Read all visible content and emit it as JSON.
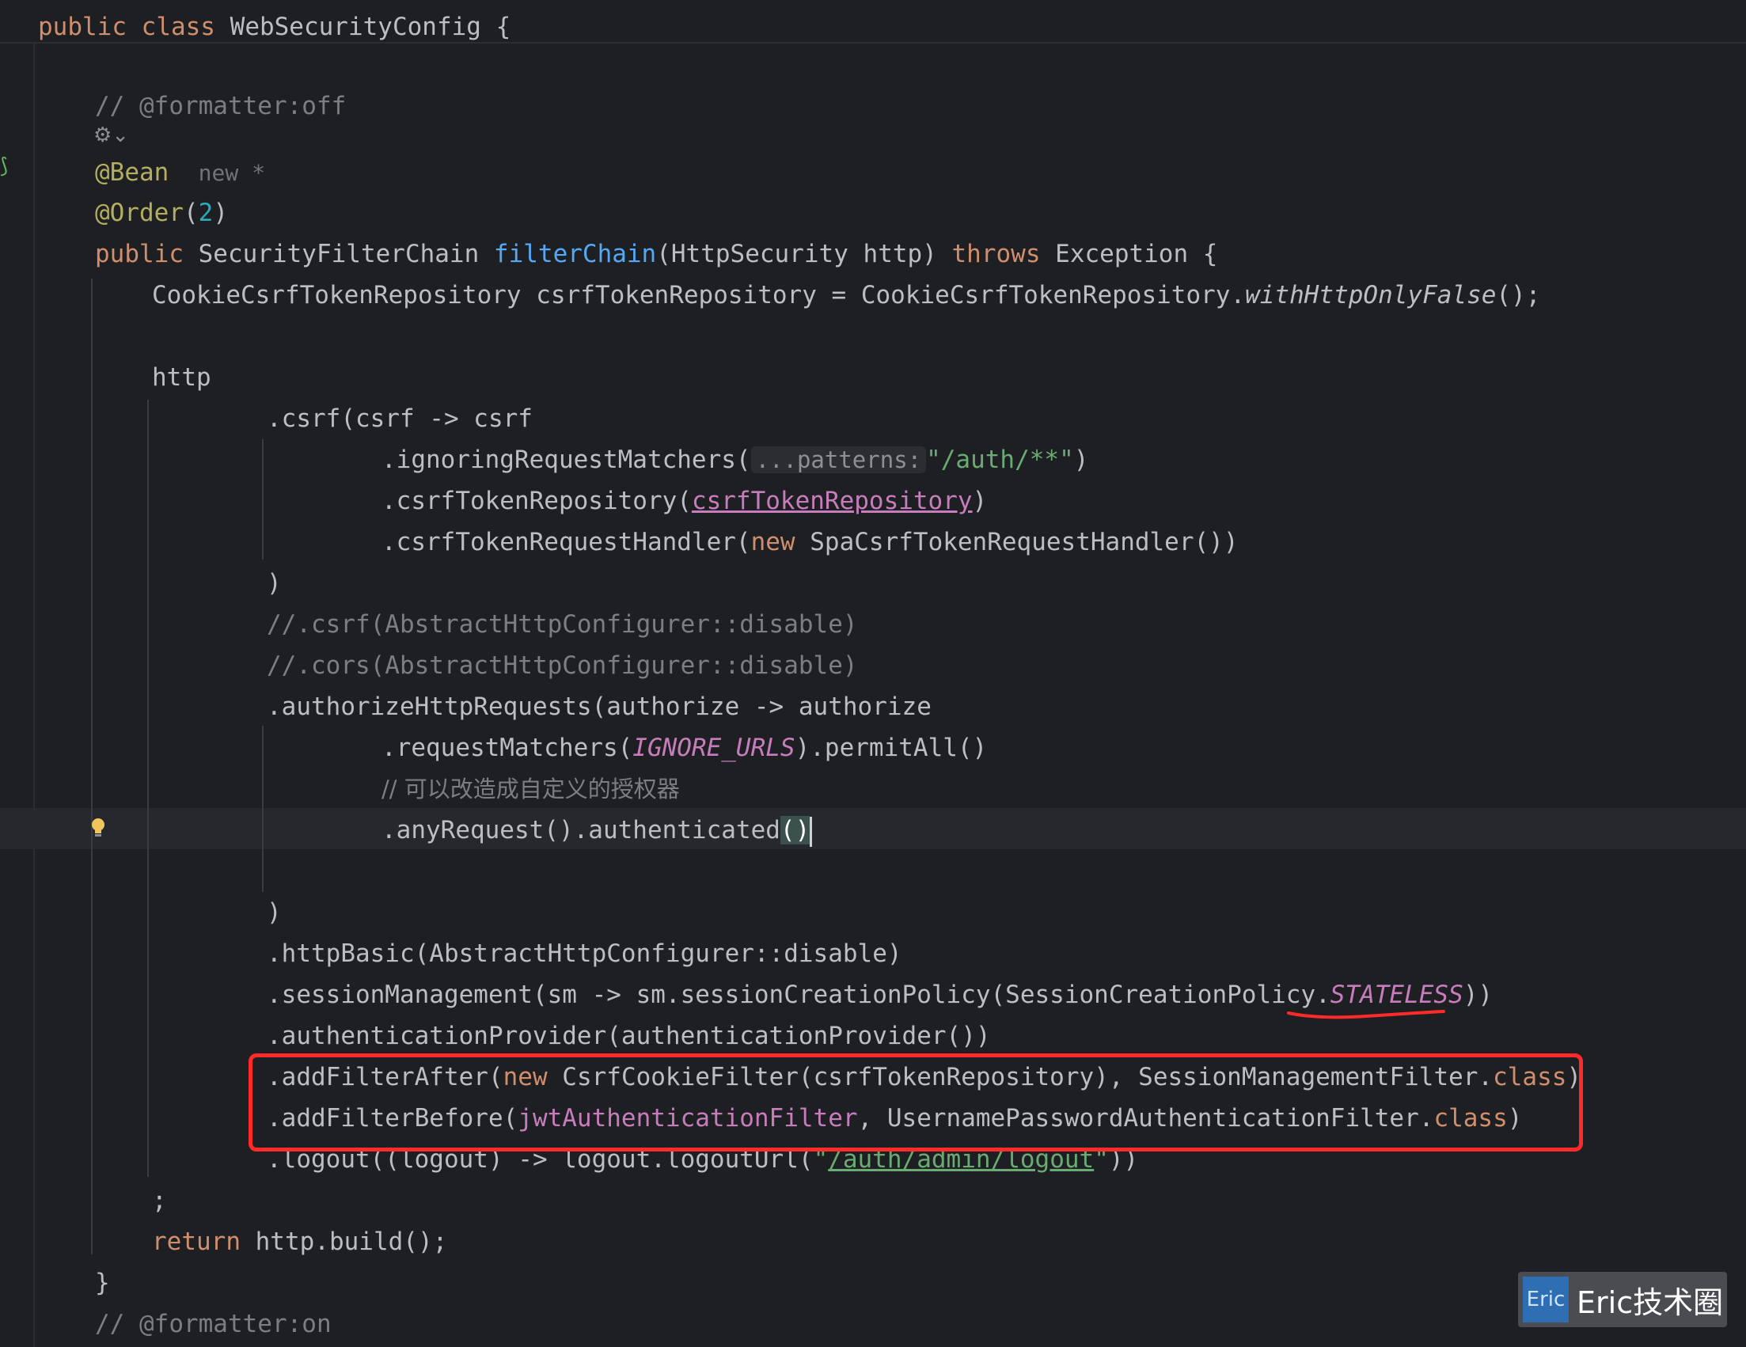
{
  "header": {
    "kw_public": "public",
    "kw_class": "class",
    "class_name": "WebSecurityConfig",
    "open_brace": "{"
  },
  "code": {
    "formatter_off": "// @formatter:off",
    "bean": "@Bean",
    "bean_hint": "new *",
    "order_ann": "@Order",
    "order_open": "(",
    "order_num": "2",
    "order_close": ")",
    "sig_public": "public",
    "sig_type": " SecurityFilterChain ",
    "sig_method": "filterChain",
    "sig_params": "(HttpSecurity http) ",
    "sig_throws": "throws",
    "sig_rest": " Exception {",
    "repo_decl": "CookieCsrfTokenRepository csrfTokenRepository = CookieCsrfTokenRepository.",
    "repo_method": "withHttpOnlyFalse",
    "repo_end": "();",
    "http": "http",
    "csrf": ".csrf(csrf -> csrf",
    "ignoring": ".ignoringRequestMatchers(",
    "ignoring_hint": "...patterns:",
    "ignoring_str": "\"/auth/**\"",
    "ignoring_end": ")",
    "token_repo": ".csrfTokenRepository(",
    "token_repo_arg": "csrfTokenRepository",
    "token_repo_end": ")",
    "handler": ".csrfTokenRequestHandler(",
    "handler_new": "new",
    "handler_rest": " SpaCsrfTokenRequestHandler())",
    "close_paren_1": ")",
    "comment_csrf": "//.csrf(AbstractHttpConfigurer::disable)",
    "comment_cors": "//.cors(AbstractHttpConfigurer::disable)",
    "authorize": ".authorizeHttpRequests(authorize -> authorize",
    "req_matchers": ".requestMatchers(",
    "req_matchers_field": "IGNORE_URLS",
    "req_matchers_end": ").permitAll()",
    "comment_cn": "// 可以改造成自定义的授权器",
    "any_request": ".anyRequest().authenticated",
    "any_request_parens": "()",
    "close_paren_2": ")",
    "http_basic": ".httpBasic(AbstractHttpConfigurer::disable)",
    "session_mgmt": ".sessionManagement(sm -> sm.sessionCreationPolicy(SessionCreationPolicy.",
    "session_field": "STATELESS",
    "session_end": "))",
    "auth_provider": ".authenticationProvider(authenticationProvider())",
    "add_after": ".addFilterAfter(",
    "add_after_new": "new",
    "add_after_mid": " CsrfCookieFilter(csrfTokenRepository), SessionManagementFilter.",
    "add_after_class": "class",
    "add_after_end": ")",
    "add_before": ".addFilterBefore(",
    "add_before_field": "jwtAuthenticationFilter",
    "add_before_mid": ", UsernamePasswordAuthenticationFilter.",
    "add_before_class": "class",
    "add_before_end": ")",
    "logout": ".logout((logout) -> logout.logoutUrl(",
    "logout_q1": "\"",
    "logout_url": "/auth/admin/logout",
    "logout_q2": "\"",
    "logout_end": "))",
    "semicolon": ";",
    "return_kw": "return",
    "return_rest": " http.build();",
    "close_method": "}",
    "formatter_on": "// @formatter:on"
  },
  "watermark": {
    "logo_text": "Eric",
    "text": "Eric技术圈"
  },
  "colors": {
    "background": "#1e1f22",
    "keyword": "#cf8e6d",
    "annotation": "#b3ae60",
    "method": "#56a8f5",
    "string": "#6aab73",
    "comment": "#7a7e85",
    "field": "#c77dbb",
    "highlight_box": "#ff2a2a"
  }
}
